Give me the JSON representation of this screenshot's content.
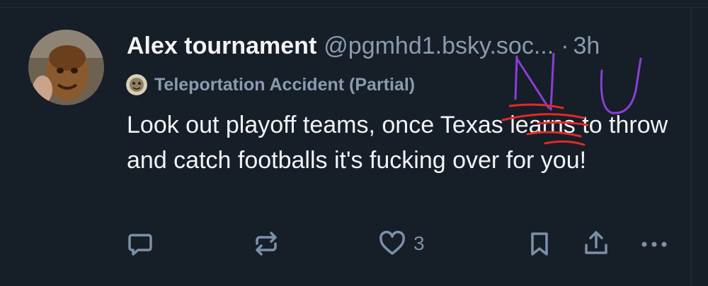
{
  "post": {
    "author": {
      "display_name": "Alex tournament",
      "handle": "@pgmhd1.bsky.soc...",
      "separator": "·",
      "time": "3h"
    },
    "label": {
      "text": "Teleportation Accident (Partial)"
    },
    "text": "Look out playoff teams, once Texas learns to throw and catch footballs it's fucking over for you!",
    "overlay_scribble": "NU",
    "actions": {
      "reply_icon": "speech-bubble-icon",
      "repost_icon": "repeat-icon",
      "like_icon": "heart-icon",
      "like_count": "3",
      "bookmark_icon": "bookmark-icon",
      "share_icon": "share-icon",
      "more_icon": "ellipsis-icon"
    }
  },
  "colors": {
    "background": "#161e27",
    "text_primary": "#f1f3f5",
    "text_secondary": "#8a9bb0",
    "icon": "#7b90aa",
    "scribble_purple": "#8a3fd6",
    "scribble_red": "#e02a2a"
  }
}
